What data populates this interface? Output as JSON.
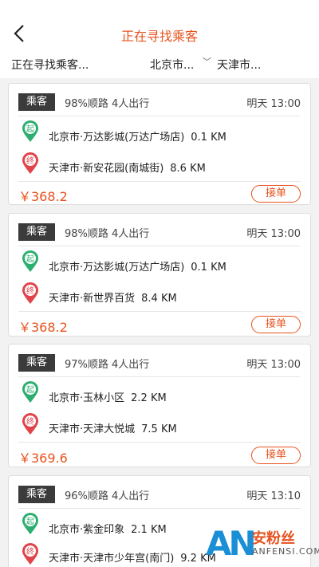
{
  "header": {
    "title": "正在寻找乘客",
    "back_icon": "chevron-left-icon"
  },
  "filter": {
    "status": "正在寻找乘客...",
    "from": "北京市...",
    "to": "天津市..."
  },
  "colors": {
    "accent": "#e8521e",
    "pickup_green": "#2bae6f",
    "dropoff_red": "#e0434a",
    "tag_bg": "#3b3b3b"
  },
  "orders": [
    {
      "tag": "乘客",
      "route": "98%顺路 4人出行",
      "time": "明天 13:00",
      "pickup_mark": "起",
      "pickup": "北京市·万达影城(万达广场店)",
      "pickup_km": "0.1 KM",
      "dropoff_mark": "终",
      "dropoff": "天津市·新安花园(南城街)",
      "dropoff_km": "8.6 KM",
      "price": "￥368.2",
      "action": "接单"
    },
    {
      "tag": "乘客",
      "route": "98%顺路 4人出行",
      "time": "明天 13:00",
      "pickup_mark": "起",
      "pickup": "北京市·万达影城(万达广场店)",
      "pickup_km": "0.1 KM",
      "dropoff_mark": "终",
      "dropoff": "天津市·新世界百货",
      "dropoff_km": "8.4 KM",
      "price": "￥368.2",
      "action": "接单"
    },
    {
      "tag": "乘客",
      "route": "97%顺路 4人出行",
      "time": "明天 13:00",
      "pickup_mark": "起",
      "pickup": "北京市·玉林小区",
      "pickup_km": "2.2 KM",
      "dropoff_mark": "终",
      "dropoff": "天津市·天津大悦城",
      "dropoff_km": "7.5 KM",
      "price": "￥369.6",
      "action": "接单"
    },
    {
      "tag": "乘客",
      "route": "96%顺路 4人出行",
      "time": "明天 13:10",
      "pickup_mark": "起",
      "pickup": "北京市·紫金印象",
      "pickup_km": "2.1 KM",
      "dropoff_mark": "终",
      "dropoff": "天津市·天津市少年宫(南门)",
      "dropoff_km": "9.2 KM",
      "price": "",
      "action": ""
    }
  ],
  "watermark": {
    "logo": "AN",
    "cn": "安粉丝",
    "en": "ANFENSI.COM"
  }
}
